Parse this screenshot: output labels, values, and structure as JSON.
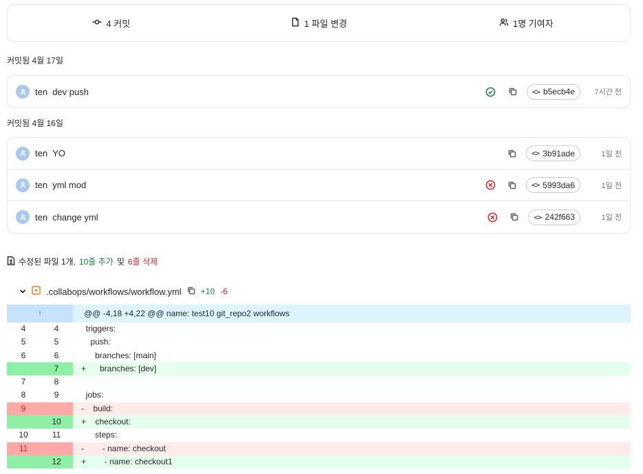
{
  "summary": {
    "commits": "4 커밋",
    "files": "1 파일 변경",
    "contributors": "1명 기여자"
  },
  "groups": [
    {
      "label": "커밋됨 4월 17일",
      "commits": [
        {
          "author": "ten",
          "message": "dev push",
          "status": "success",
          "sha": "b5ecb4e",
          "time": "7시간 전"
        }
      ]
    },
    {
      "label": "커밋됨 4월 16일",
      "commits": [
        {
          "author": "ten",
          "message": "YO",
          "status": "none",
          "sha": "3b91ade",
          "time": "1일 전"
        },
        {
          "author": "ten",
          "message": "yml mod",
          "status": "failure",
          "sha": "5993da6",
          "time": "1일 전"
        },
        {
          "author": "ten",
          "message": "change yml",
          "status": "failure",
          "sha": "242f663",
          "time": "1일 전"
        }
      ]
    }
  ],
  "changes": {
    "prefix": "수정된 파일 1개,",
    "added": "10줄 추가",
    "joiner": "및",
    "deleted": "6줄 삭제"
  },
  "file": {
    "path": ".collabops/workflows/workflow.yml",
    "additions": "+10",
    "deletions": "-6"
  },
  "diff": {
    "hunk_header": "@@ -4,18 +4,22 @@ name: test10 git_repo2 workflows",
    "expand_icon": "↑",
    "lines": [
      {
        "type": "ctx",
        "old": "4",
        "new": "4",
        "code": "  triggers:"
      },
      {
        "type": "ctx",
        "old": "5",
        "new": "5",
        "code": "    push:"
      },
      {
        "type": "ctx",
        "old": "6",
        "new": "6",
        "code": "      branches: [main]"
      },
      {
        "type": "add",
        "old": "",
        "new": "7",
        "code": "+      branches: [dev]"
      },
      {
        "type": "ctx",
        "old": "7",
        "new": "8",
        "code": ""
      },
      {
        "type": "ctx",
        "old": "8",
        "new": "9",
        "code": "  jobs:"
      },
      {
        "type": "del",
        "old": "9",
        "new": "",
        "code": "-    build:"
      },
      {
        "type": "add",
        "old": "",
        "new": "10",
        "code": "+    checkout:"
      },
      {
        "type": "ctx",
        "old": "10",
        "new": "11",
        "code": "      steps:"
      },
      {
        "type": "del",
        "old": "11",
        "new": "",
        "code": "-        - name: checkout"
      },
      {
        "type": "add",
        "old": "",
        "new": "12",
        "code": "+        - name: checkout1"
      }
    ]
  },
  "colors": {
    "add": "#1a7f37",
    "delete": "#cf222e",
    "success": "#1a7f37",
    "failure": "#cf222e",
    "file_icon": "#e5802a"
  }
}
